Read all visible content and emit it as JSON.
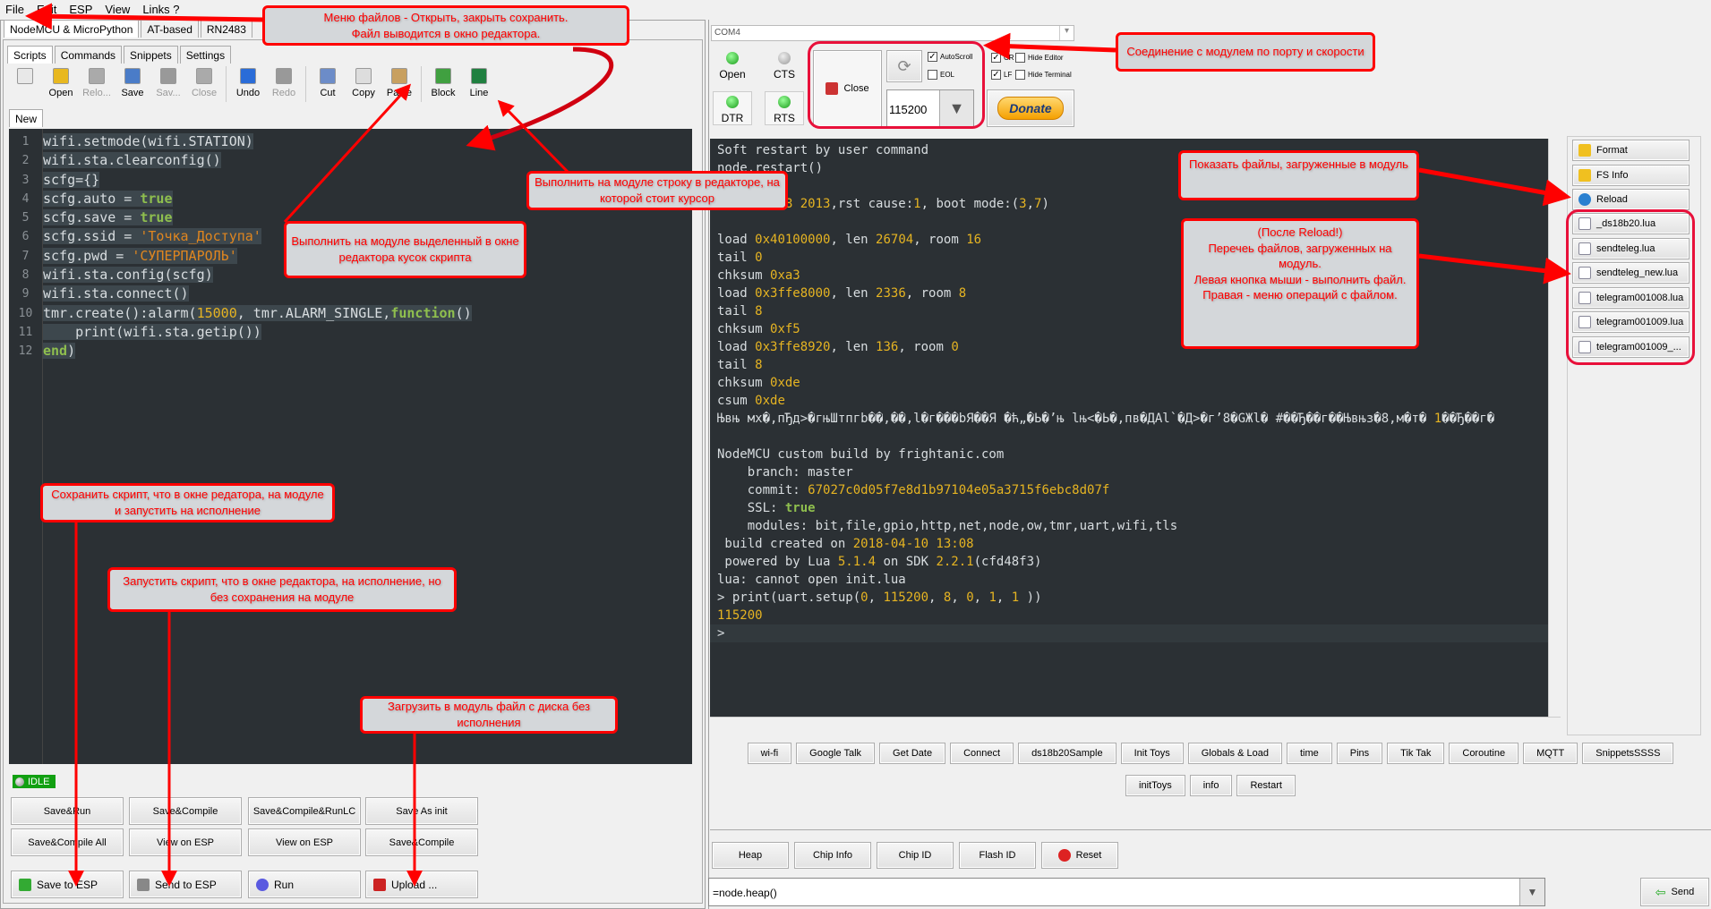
{
  "menu": [
    "File",
    "Edit",
    "ESP",
    "View",
    "Links ?"
  ],
  "main_tabs": [
    "NodeMCU & MicroPython",
    "AT-based",
    "RN2483"
  ],
  "sub_tabs": [
    "Scripts",
    "Commands",
    "Snippets",
    "Settings"
  ],
  "toolbar": [
    {
      "label": "",
      "icon": "new-file-icon",
      "color": "#e8e8e8",
      "enabled": true
    },
    {
      "label": "Open",
      "icon": "folder-icon",
      "color": "#e8b820",
      "enabled": true
    },
    {
      "label": "Relo...",
      "icon": "reload-icon",
      "color": "#aaaaaa",
      "enabled": false
    },
    {
      "label": "Save",
      "icon": "floppy-icon",
      "color": "#4a7cc8",
      "enabled": true
    },
    {
      "label": "Sav...",
      "icon": "floppy-icon",
      "color": "#999999",
      "enabled": false
    },
    {
      "label": "Close",
      "icon": "close-file-icon",
      "color": "#aaaaaa",
      "enabled": false
    },
    {
      "label": "Undo",
      "icon": "undo-icon",
      "color": "#2a6cd8",
      "enabled": true
    },
    {
      "label": "Redo",
      "icon": "redo-icon",
      "color": "#999999",
      "enabled": false
    },
    {
      "label": "Cut",
      "icon": "scissors-icon",
      "color": "#6c8cc8",
      "enabled": true
    },
    {
      "label": "Copy",
      "icon": "copy-icon",
      "color": "#dddddd",
      "enabled": true
    },
    {
      "label": "Paste",
      "icon": "paste-icon",
      "color": "#c8a060",
      "enabled": true
    },
    {
      "label": "Block",
      "icon": "run-block-icon",
      "color": "#40a040",
      "enabled": true
    },
    {
      "label": "Line",
      "icon": "run-line-icon",
      "color": "#208040",
      "enabled": true
    }
  ],
  "editor_tab": "New",
  "editor_lines": [
    [
      [
        "wifi.setmode(wifi.STATION)",
        "w"
      ]
    ],
    [
      [
        "wifi.sta.clearconfig()",
        "w"
      ]
    ],
    [
      [
        "scfg={}",
        "w"
      ]
    ],
    [
      [
        "scfg.auto = ",
        "w"
      ],
      [
        "true",
        "g"
      ]
    ],
    [
      [
        "scfg.save = ",
        "w"
      ],
      [
        "true",
        "g"
      ]
    ],
    [
      [
        "scfg.ssid = ",
        "w"
      ],
      [
        "'Точка_Доступа'",
        "o"
      ]
    ],
    [
      [
        "scfg.pwd = ",
        "w"
      ],
      [
        "'СУПЕРПАРОЛЬ'",
        "o"
      ]
    ],
    [
      [
        "wifi.sta.config(scfg)",
        "w"
      ]
    ],
    [
      [
        "wifi.sta.connect()",
        "w"
      ]
    ],
    [
      [
        "tmr.create():alarm(",
        "w"
      ],
      [
        "15000",
        "y"
      ],
      [
        ", tmr.ALARM_SINGLE,",
        "w"
      ],
      [
        "function",
        "g"
      ],
      [
        "()",
        "w"
      ]
    ],
    [
      [
        "    print(wifi.sta.getip())",
        "w"
      ]
    ],
    [
      [
        "end",
        "g"
      ],
      [
        ")",
        "w"
      ]
    ]
  ],
  "status": "IDLE",
  "script_buttons": [
    "Save&Run",
    "Save&Compile",
    "Save&Compile&RunLC",
    "Save As init",
    "Save&Compile All",
    "View on ESP",
    "View on ESP",
    "Save&Compile"
  ],
  "action_buttons": [
    {
      "label": "Save to ESP",
      "icon": "save-to-esp-icon"
    },
    {
      "label": "Send to ESP",
      "icon": "send-script-icon"
    },
    {
      "label": "Run",
      "icon": "run-icon"
    },
    {
      "label": "Upload ...",
      "icon": "upload-icon"
    }
  ],
  "port": "COM4",
  "leds": {
    "open": "Open",
    "cts": "CTS",
    "dtr": "DTR",
    "rts": "RTS"
  },
  "close_label": "Close",
  "baud": "115200",
  "checks": {
    "autoscroll": "AutoScroll",
    "eol": "EOL",
    "cr": "CR",
    "lf": "LF",
    "hide_editor": "Hide Editor",
    "hide_terminal": "Hide Terminal"
  },
  "donate": "Donate",
  "terminal_lines": [
    [
      [
        "Soft restart by user command",
        "w"
      ]
    ],
    [
      [
        "node.restart()",
        "w"
      ]
    ],
    [
      [
        "",
        "w"
      ]
    ],
    [
      [
        "ets Jan  ",
        "w"
      ],
      [
        "8 2013",
        "y"
      ],
      [
        ",rst cause:",
        "w"
      ],
      [
        "1",
        "y"
      ],
      [
        ", boot mode:(",
        "w"
      ],
      [
        "3",
        "y"
      ],
      [
        ",",
        "w"
      ],
      [
        "7",
        "y"
      ],
      [
        ")",
        "w"
      ]
    ],
    [
      [
        "",
        "w"
      ]
    ],
    [
      [
        "load ",
        "w"
      ],
      [
        "0x40100000",
        "y"
      ],
      [
        ", len ",
        "w"
      ],
      [
        "26704",
        "y"
      ],
      [
        ", room ",
        "w"
      ],
      [
        "16",
        "y"
      ]
    ],
    [
      [
        "tail ",
        "w"
      ],
      [
        "0",
        "y"
      ]
    ],
    [
      [
        "chksum ",
        "w"
      ],
      [
        "0xa3",
        "y"
      ]
    ],
    [
      [
        "load ",
        "w"
      ],
      [
        "0x3ffe8000",
        "y"
      ],
      [
        ", len ",
        "w"
      ],
      [
        "2336",
        "y"
      ],
      [
        ", room ",
        "w"
      ],
      [
        "8",
        "y"
      ]
    ],
    [
      [
        "tail ",
        "w"
      ],
      [
        "8",
        "y"
      ]
    ],
    [
      [
        "chksum ",
        "w"
      ],
      [
        "0xf5",
        "y"
      ]
    ],
    [
      [
        "load ",
        "w"
      ],
      [
        "0x3ffe8920",
        "y"
      ],
      [
        ", len ",
        "w"
      ],
      [
        "136",
        "y"
      ],
      [
        ", room ",
        "w"
      ],
      [
        "0",
        "y"
      ]
    ],
    [
      [
        "tail ",
        "w"
      ],
      [
        "8",
        "y"
      ]
    ],
    [
      [
        "chksum ",
        "w"
      ],
      [
        "0xde",
        "y"
      ]
    ],
    [
      [
        "csum ",
        "w"
      ],
      [
        "0xde",
        "y"
      ]
    ],
    [
      [
        "Њвњ мх�,пЂд>�гњШтпгb��,��,l�г���bЯ��Я �ћ„�Ь�’њ lњ<�Ь�,пв�ДАl`�Д>�г’8�GЖl� #��Ђ��г��Њвњз�8,м�т� ",
        "w"
      ],
      [
        "1",
        "y"
      ],
      [
        "��Ђ��г�",
        "w"
      ]
    ],
    [
      [
        "",
        "w"
      ]
    ],
    [
      [
        "NodeMCU custom build by frightanic.com",
        "w"
      ]
    ],
    [
      [
        "    branch: master",
        "w"
      ]
    ],
    [
      [
        "    commit: ",
        "w"
      ],
      [
        "67027c0d05f7e8d1b97104e05a3715f6ebc8d07f",
        "y"
      ]
    ],
    [
      [
        "    SSL: ",
        "w"
      ],
      [
        "true",
        "g"
      ]
    ],
    [
      [
        "    modules: bit,file,gpio,http,net,node,ow,tmr,uart,wifi,tls",
        "w"
      ]
    ],
    [
      [
        " build created on ",
        "w"
      ],
      [
        "2018-04-10 13:08",
        "y"
      ]
    ],
    [
      [
        " powered by Lua ",
        "w"
      ],
      [
        "5.1.4",
        "y"
      ],
      [
        " on SDK ",
        "w"
      ],
      [
        "2.2.1",
        "y"
      ],
      [
        "(cfd48f3)",
        "w"
      ]
    ],
    [
      [
        "lua: cannot open init.lua",
        "w"
      ]
    ],
    [
      [
        "> print(uart.setup(",
        "w"
      ],
      [
        "0",
        "y"
      ],
      [
        ", ",
        "w"
      ],
      [
        "115200",
        "y"
      ],
      [
        ", ",
        "w"
      ],
      [
        "8",
        "y"
      ],
      [
        ", ",
        "w"
      ],
      [
        "0",
        "y"
      ],
      [
        ", ",
        "w"
      ],
      [
        "1",
        "y"
      ],
      [
        ", ",
        "w"
      ],
      [
        "1",
        "y"
      ],
      [
        " ))",
        "w"
      ]
    ],
    [
      [
        "115200",
        "y"
      ]
    ],
    [
      [
        ">",
        "w"
      ]
    ]
  ],
  "fs_buttons": [
    {
      "label": "Format",
      "icon": "format-icon"
    },
    {
      "label": "FS Info",
      "icon": "fs-info-icon"
    },
    {
      "label": "Reload",
      "icon": "reload-icon"
    }
  ],
  "files": [
    "_ds18b20.lua",
    "sendteleg.lua",
    "sendteleg_new.lua",
    "telegram001008.lua",
    "telegram001009.lua",
    "telegram001009_..."
  ],
  "snippets": [
    "wi-fi",
    "Google Talk",
    "Get Date",
    "Connect",
    "ds18b20Sample",
    "Init Toys",
    "Globals & Load",
    "time",
    "Pins",
    "Tik Tak",
    "Coroutine",
    "MQTT",
    "SnippetsSSSS",
    "initToys",
    "info",
    "Restart"
  ],
  "bottom_buttons": [
    "Heap",
    "Chip Info",
    "Chip ID",
    "Flash ID",
    "Reset"
  ],
  "command_input": "=node.heap()",
  "send": "Send",
  "annotations": {
    "file_menu": "Меню файлов - Открыть, закрыть сохранить.\nФайл выводится в окно редактора.",
    "connection": "Соединение с модулем по порту и скорости",
    "run_line": "Выполнить на модуле строку в редакторе, на которой стоит курсор",
    "run_block": "Выполнить на модуле выделенный в окне редактора кусок скрипта",
    "show_files": "Показать файлы, загруженные в модуль",
    "file_list": "(После Reload!)\nПеречеь файлов, загруженных на модуль.\nЛевая кнопка мыши - выполнить файл.\nПравая - меню операций с файлом.",
    "save_to_esp": "Сохранить скрипт, что в окне редатора, на модуле и запустить на исполнение",
    "send_to_esp": "Запустить скрипт, что в окне редактора, на исполнение, но без сохранения на модуле",
    "upload": "Загрузить в модуль файл с диска без исполнения"
  },
  "colors": {
    "annotation": "#ff0000",
    "editor_bg": "#2b3034",
    "idle": "#12a012"
  }
}
